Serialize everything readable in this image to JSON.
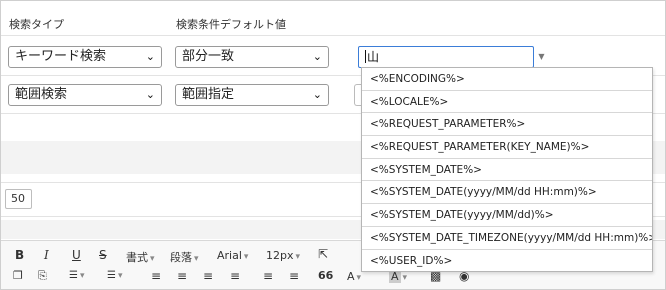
{
  "headers": {
    "search_type": "検索タイプ",
    "default_value": "検索条件デフォルト値"
  },
  "row1": {
    "type_value": "キーワード検索",
    "match_value": "部分一致",
    "input_value": "山"
  },
  "row2": {
    "type_value": "範囲検索",
    "match_value": "範囲指定"
  },
  "dropdown": {
    "items": [
      "<%ENCODING%>",
      "<%LOCALE%>",
      "<%REQUEST_PARAMETER%>",
      "<%REQUEST_PARAMETER(KEY_NAME)%>",
      "<%SYSTEM_DATE%>",
      "<%SYSTEM_DATE(yyyy/MM/dd HH:mm)%>",
      "<%SYSTEM_DATE(yyyy/MM/dd)%>",
      "<%SYSTEM_DATE_TIMEZONE(yyyy/MM/dd HH:mm)%>",
      "<%USER_ID%>"
    ]
  },
  "page_size_value": "50",
  "editor_toolbar": {
    "bold": "B",
    "italic": "I",
    "underline": "U",
    "strike": "S",
    "format": "書式",
    "paragraph": "段落",
    "font": "Arial",
    "size": "12px",
    "quote": "66",
    "text_color": "A",
    "bg_color": "A"
  }
}
